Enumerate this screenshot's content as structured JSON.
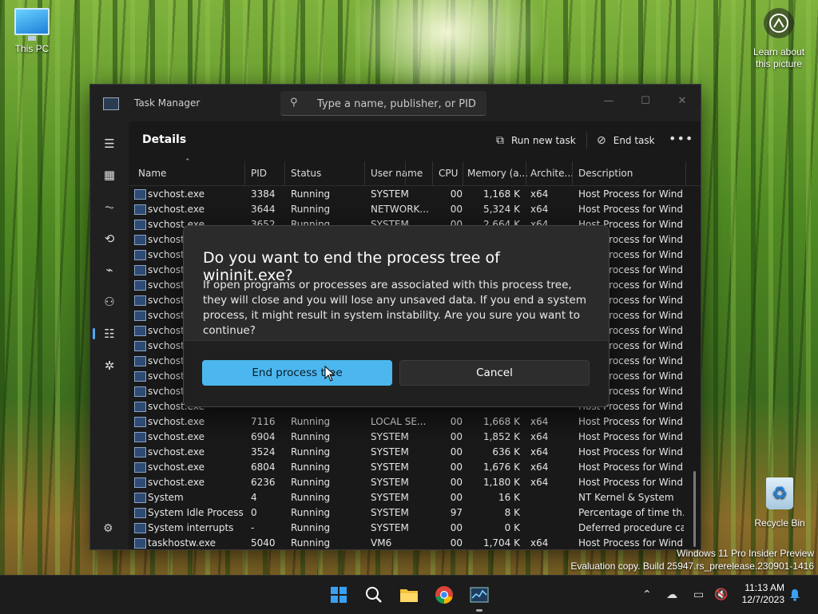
{
  "desktop": {
    "this_pc_label": "This PC",
    "learn_label_line1": "Learn about",
    "learn_label_line2": "this picture",
    "recycle_bin_label": "Recycle Bin"
  },
  "window": {
    "title": "Task Manager",
    "search_placeholder": "Type a name, publisher, or PID...",
    "minimize": "—",
    "maximize": "☐",
    "close": "✕"
  },
  "toolbar": {
    "page_title": "Details",
    "run_new_task_label": "Run new task",
    "end_task_label": "End task",
    "more_label": "•••"
  },
  "table": {
    "columns": [
      "Name",
      "PID",
      "Status",
      "User name",
      "CPU",
      "Memory (a...",
      "Archite...",
      "Description"
    ],
    "rows": [
      {
        "name": "svchost.exe",
        "pid": "3384",
        "status": "Running",
        "user": "SYSTEM",
        "cpu": "00",
        "mem": "1,168 K",
        "arch": "x64",
        "desc": "Host Process for Wind..."
      },
      {
        "name": "svchost.exe",
        "pid": "3644",
        "status": "Running",
        "user": "NETWORK...",
        "cpu": "00",
        "mem": "5,324 K",
        "arch": "x64",
        "desc": "Host Process for Wind..."
      },
      {
        "name": "svchost.exe",
        "pid": "3652",
        "status": "Running",
        "user": "SYSTEM",
        "cpu": "00",
        "mem": "2,664 K",
        "arch": "x64",
        "desc": "Host Process for Wind..."
      },
      {
        "name": "svchost.exe",
        "pid": "",
        "status": "",
        "user": "",
        "cpu": "",
        "mem": "",
        "arch": "",
        "desc": "Host Process for Wind..."
      },
      {
        "name": "svchost.exe",
        "pid": "",
        "status": "",
        "user": "",
        "cpu": "",
        "mem": "",
        "arch": "",
        "desc": "Host Process for Wind..."
      },
      {
        "name": "svchost.exe",
        "pid": "",
        "status": "",
        "user": "",
        "cpu": "",
        "mem": "",
        "arch": "",
        "desc": "Host Process for Wind..."
      },
      {
        "name": "svchost.exe",
        "pid": "",
        "status": "",
        "user": "",
        "cpu": "",
        "mem": "",
        "arch": "",
        "desc": "Host Process for Wind..."
      },
      {
        "name": "svchost.exe",
        "pid": "",
        "status": "",
        "user": "",
        "cpu": "",
        "mem": "",
        "arch": "",
        "desc": "Host Process for Wind..."
      },
      {
        "name": "svchost.exe",
        "pid": "",
        "status": "",
        "user": "",
        "cpu": "",
        "mem": "",
        "arch": "",
        "desc": "Host Process for Wind..."
      },
      {
        "name": "svchost.exe",
        "pid": "",
        "status": "",
        "user": "",
        "cpu": "",
        "mem": "",
        "arch": "",
        "desc": "Host Process for Wind..."
      },
      {
        "name": "svchost.exe",
        "pid": "",
        "status": "",
        "user": "",
        "cpu": "",
        "mem": "",
        "arch": "",
        "desc": "Host Process for Wind..."
      },
      {
        "name": "svchost.exe",
        "pid": "",
        "status": "",
        "user": "",
        "cpu": "",
        "mem": "",
        "arch": "",
        "desc": "Host Process for Wind..."
      },
      {
        "name": "svchost.exe",
        "pid": "",
        "status": "",
        "user": "",
        "cpu": "",
        "mem": "",
        "arch": "",
        "desc": "Host Process for Wind..."
      },
      {
        "name": "svchost.exe",
        "pid": "",
        "status": "",
        "user": "",
        "cpu": "",
        "mem": "",
        "arch": "",
        "desc": "Host Process for Wind..."
      },
      {
        "name": "svchost.exe",
        "pid": "",
        "status": "",
        "user": "",
        "cpu": "",
        "mem": "",
        "arch": "",
        "desc": "Host Process for Wind..."
      },
      {
        "name": "svchost.exe",
        "pid": "7116",
        "status": "Running",
        "user": "LOCAL SE...",
        "cpu": "00",
        "mem": "1,668 K",
        "arch": "x64",
        "desc": "Host Process for Wind..."
      },
      {
        "name": "svchost.exe",
        "pid": "6904",
        "status": "Running",
        "user": "SYSTEM",
        "cpu": "00",
        "mem": "1,852 K",
        "arch": "x64",
        "desc": "Host Process for Wind..."
      },
      {
        "name": "svchost.exe",
        "pid": "3524",
        "status": "Running",
        "user": "SYSTEM",
        "cpu": "00",
        "mem": "636 K",
        "arch": "x64",
        "desc": "Host Process for Wind..."
      },
      {
        "name": "svchost.exe",
        "pid": "6804",
        "status": "Running",
        "user": "SYSTEM",
        "cpu": "00",
        "mem": "1,676 K",
        "arch": "x64",
        "desc": "Host Process for Wind..."
      },
      {
        "name": "svchost.exe",
        "pid": "6236",
        "status": "Running",
        "user": "SYSTEM",
        "cpu": "00",
        "mem": "1,180 K",
        "arch": "x64",
        "desc": "Host Process for Wind..."
      },
      {
        "name": "System",
        "pid": "4",
        "status": "Running",
        "user": "SYSTEM",
        "cpu": "00",
        "mem": "16 K",
        "arch": "",
        "desc": "NT Kernel & System"
      },
      {
        "name": "System Idle Process",
        "pid": "0",
        "status": "Running",
        "user": "SYSTEM",
        "cpu": "97",
        "mem": "8 K",
        "arch": "",
        "desc": "Percentage of time th..."
      },
      {
        "name": "System interrupts",
        "pid": "-",
        "status": "Running",
        "user": "SYSTEM",
        "cpu": "00",
        "mem": "0 K",
        "arch": "",
        "desc": "Deferred procedure ca..."
      },
      {
        "name": "taskhostw.exe",
        "pid": "5040",
        "status": "Running",
        "user": "VM6",
        "cpu": "00",
        "mem": "1,704 K",
        "arch": "x64",
        "desc": "Host Process for Wind..."
      }
    ]
  },
  "dialog": {
    "title": "Do you want to end the process tree of wininit.exe?",
    "body": "If open programs or processes are associated with this process tree, they will close and you will lose any unsaved data. If you end a system process, it might result in system instability. Are you sure you want to continue?",
    "primary_label": "End process tree",
    "secondary_label": "Cancel"
  },
  "watermark": {
    "line1": "Windows 11 Pro Insider Preview",
    "line2": "Evaluation copy. Build 25947.rs_prerelease.230901-1416"
  },
  "clock": {
    "time": "11:13 AM",
    "date": "12/7/2023"
  },
  "colors": {
    "accent": "#4cb7ee",
    "window_bg": "#202020",
    "dialog_bg": "#2b2b2b"
  },
  "icons": {
    "taskbar": [
      "start-icon",
      "search-icon",
      "file-explorer-icon",
      "chrome-icon",
      "task-manager-icon"
    ],
    "tray": [
      "chevron-up-icon",
      "onedrive-icon",
      "network-icon",
      "volume-muted-icon",
      "notification-bell-icon"
    ]
  }
}
